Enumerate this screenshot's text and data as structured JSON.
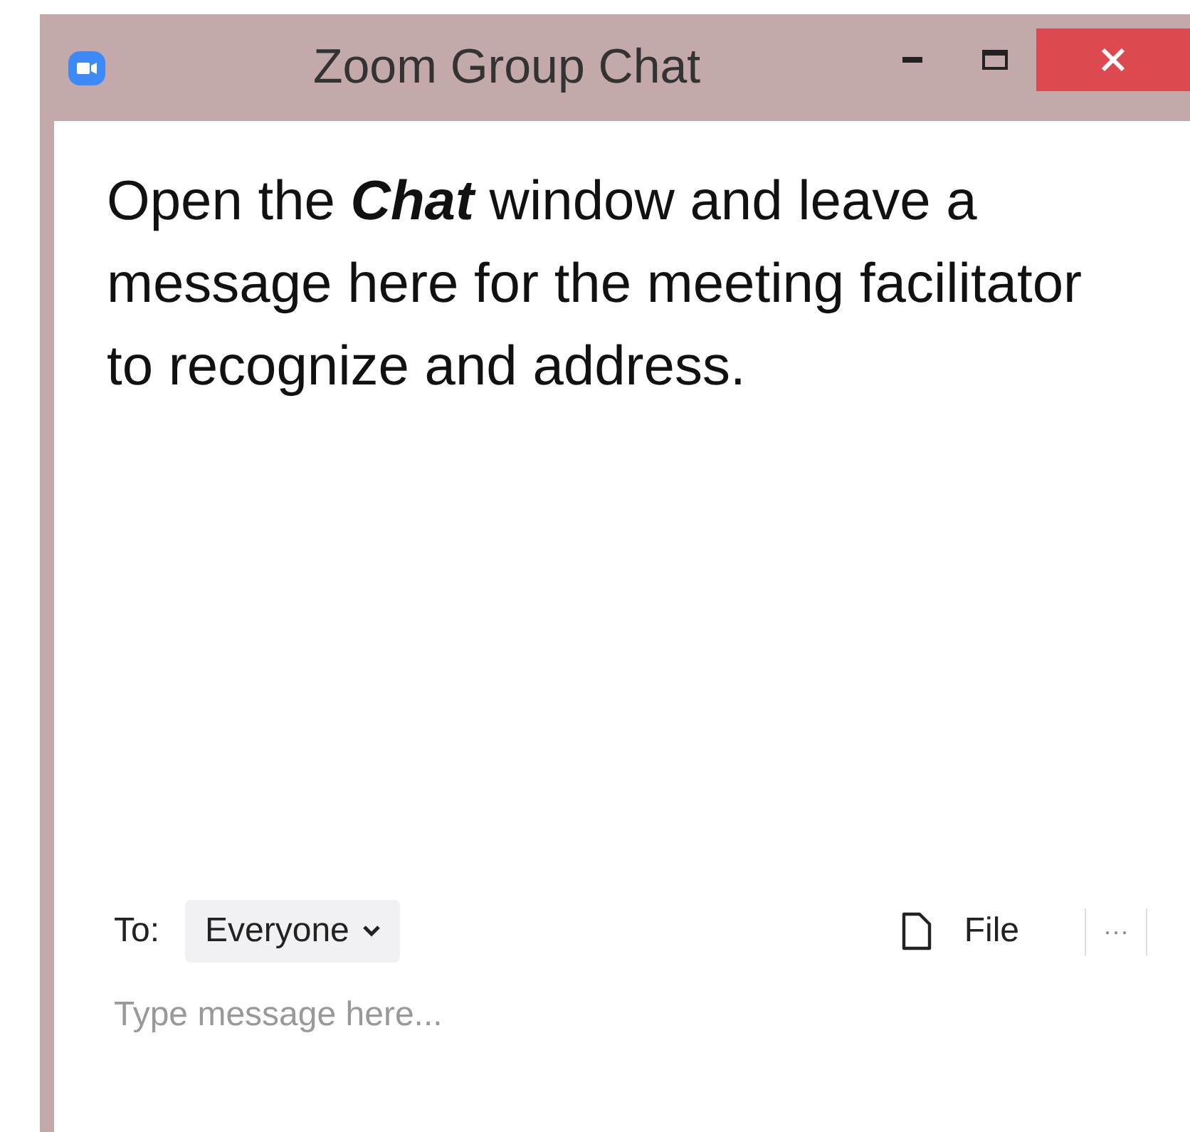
{
  "window": {
    "title": "Zoom Group Chat"
  },
  "message": "Open the *Chat* window and leave a message here for the meeting facilitator to recognize and address.",
  "composer": {
    "to_label": "To:",
    "recipient": "Everyone",
    "file_label": "File",
    "more_label": "···",
    "placeholder": "Type message here..."
  }
}
